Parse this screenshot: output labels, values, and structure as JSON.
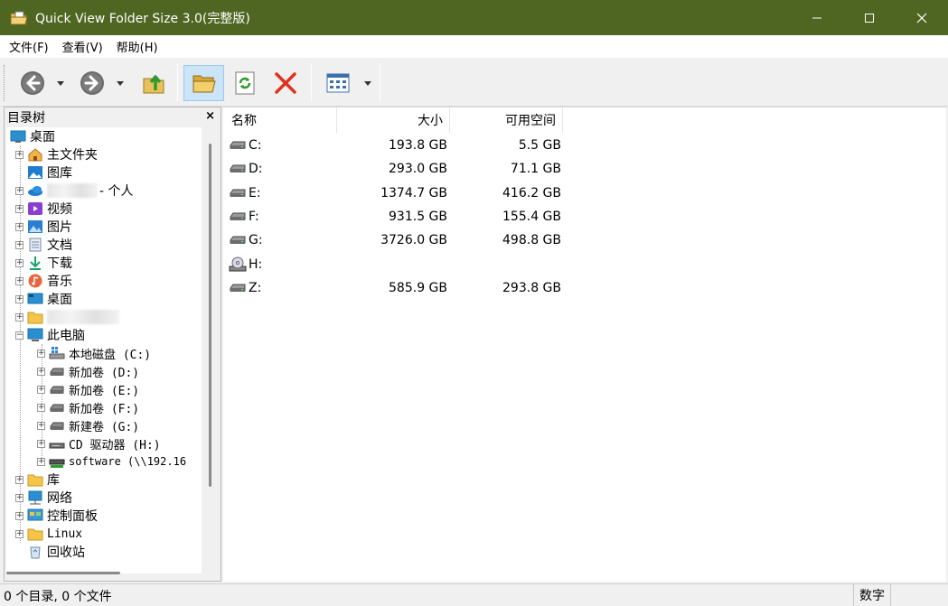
{
  "window": {
    "title": "Quick View Folder Size 3.0(完整版)",
    "minimize_glyph": "—",
    "maximize_glyph": "☐",
    "close_glyph": "✕",
    "colors": {
      "titlebar": "#4e6621",
      "selection": "#cce4f7"
    }
  },
  "menu": {
    "items": [
      {
        "label": "文件(F)"
      },
      {
        "label": "查看(V)"
      },
      {
        "label": "帮助(H)"
      }
    ]
  },
  "toolbar": {
    "buttons": [
      "back-icon",
      "forward-icon",
      "up-folder-icon",
      "open-folder-icon",
      "refresh-icon",
      "delete-icon",
      "view-mode-icon"
    ]
  },
  "tree": {
    "header": "目录树",
    "close_glyph": "×",
    "nodes": [
      {
        "label": "桌面",
        "icon": "desktop-icon"
      },
      {
        "label": "主文件夹",
        "icon": "home-icon"
      },
      {
        "label": "图库",
        "icon": "gallery-icon"
      },
      {
        "label": "- 个人",
        "icon": "onedrive-icon"
      },
      {
        "label": "视频",
        "icon": "video-icon"
      },
      {
        "label": "图片",
        "icon": "pictures-icon"
      },
      {
        "label": "文档",
        "icon": "documents-icon"
      },
      {
        "label": "下载",
        "icon": "download-icon"
      },
      {
        "label": "音乐",
        "icon": "music-icon"
      },
      {
        "label": "桌面",
        "icon": "desktop-icon"
      },
      {
        "label": "",
        "icon": "folder-icon"
      },
      {
        "label": "此电脑",
        "icon": "computer-icon"
      },
      {
        "label": "本地磁盘 (C:)",
        "icon": "system-drive-icon"
      },
      {
        "label": "新加卷 (D:)",
        "icon": "drive-icon"
      },
      {
        "label": "新加卷 (E:)",
        "icon": "drive-icon"
      },
      {
        "label": "新加卷 (F:)",
        "icon": "drive-icon"
      },
      {
        "label": "新建卷 (G:)",
        "icon": "drive-icon"
      },
      {
        "label": "CD 驱动器 (H:)",
        "icon": "cd-drive-icon"
      },
      {
        "label": "software (\\\\192.16",
        "icon": "network-drive-icon"
      },
      {
        "label": "库",
        "icon": "folder-icon"
      },
      {
        "label": "网络",
        "icon": "network-icon"
      },
      {
        "label": "控制面板",
        "icon": "control-panel-icon"
      },
      {
        "label": "Linux",
        "icon": "folder-icon"
      },
      {
        "label": "回收站",
        "icon": "recycle-bin-icon"
      }
    ]
  },
  "list": {
    "columns": {
      "name": "名称",
      "size": "大小",
      "free": "可用空间"
    },
    "rows": [
      {
        "name": "C:",
        "size": "193.8 GB",
        "free": "5.5 GB",
        "icon": "drive-icon"
      },
      {
        "name": "D:",
        "size": "293.0 GB",
        "free": "71.1 GB",
        "icon": "drive-icon"
      },
      {
        "name": "E:",
        "size": "1374.7 GB",
        "free": "416.2 GB",
        "icon": "drive-icon"
      },
      {
        "name": "F:",
        "size": "931.5 GB",
        "free": "155.4 GB",
        "icon": "drive-icon"
      },
      {
        "name": "G:",
        "size": "3726.0 GB",
        "free": "498.8 GB",
        "icon": "drive-icon"
      },
      {
        "name": "H:",
        "size": "",
        "free": "",
        "icon": "cd-drive-icon"
      },
      {
        "name": "Z:",
        "size": "585.9 GB",
        "free": "293.8 GB",
        "icon": "drive-icon"
      }
    ]
  },
  "status": {
    "left": "0 个目录, 0 个文件",
    "numlock": "数字"
  }
}
